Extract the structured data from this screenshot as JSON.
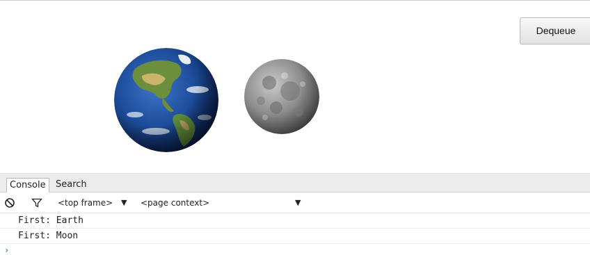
{
  "header": {
    "dequeue_label": "Dequeue"
  },
  "stage": {
    "items": [
      "earth-image",
      "moon-image"
    ]
  },
  "devtools": {
    "tabs": [
      {
        "label": "Console",
        "active": true
      },
      {
        "label": "Search",
        "active": false
      }
    ],
    "toolbar": {
      "frame_select": "<top frame>",
      "context_select": "<page context>",
      "icons": [
        "clear-console-icon",
        "filter-icon",
        "chevron-down-icon"
      ]
    },
    "console_lines": [
      "First: Earth",
      "First: Moon"
    ],
    "prompt_symbol": "›"
  },
  "colors": {
    "tab_bar_bg": "#ececec",
    "prompt_blue": "#3c7ee0"
  }
}
